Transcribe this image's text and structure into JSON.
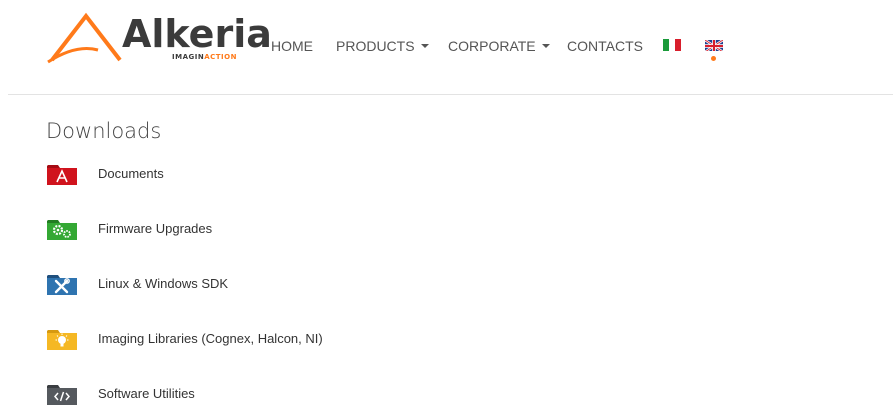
{
  "logo": {
    "word": "Alkeria",
    "tag_a": "IMAGIN",
    "tag_b": "ACTION"
  },
  "nav": {
    "home": "HOME",
    "products": "PRODUCTS",
    "corporate": "CORPORATE",
    "contacts": "CONTACTS"
  },
  "languages": {
    "italian": "it-flag-icon",
    "english": "uk-flag-icon",
    "active": "english"
  },
  "colors": {
    "accent": "#ff7a1a",
    "documents": "#c8101a",
    "firmware": "#2f9e2f",
    "sdk": "#2b6ea8",
    "imaging": "#f2b41c",
    "software": "#4f5358"
  },
  "page": {
    "title": "Downloads"
  },
  "downloads": [
    {
      "label": "Documents",
      "icon": "pdf-icon"
    },
    {
      "label": "Firmware Upgrades",
      "icon": "gears-icon"
    },
    {
      "label": "Linux & Windows SDK",
      "icon": "tools-icon"
    },
    {
      "label": "Imaging Libraries (Cognex, Halcon, NI)",
      "icon": "lightbulb-icon"
    },
    {
      "label": "Software Utilities",
      "icon": "code-icon"
    }
  ]
}
